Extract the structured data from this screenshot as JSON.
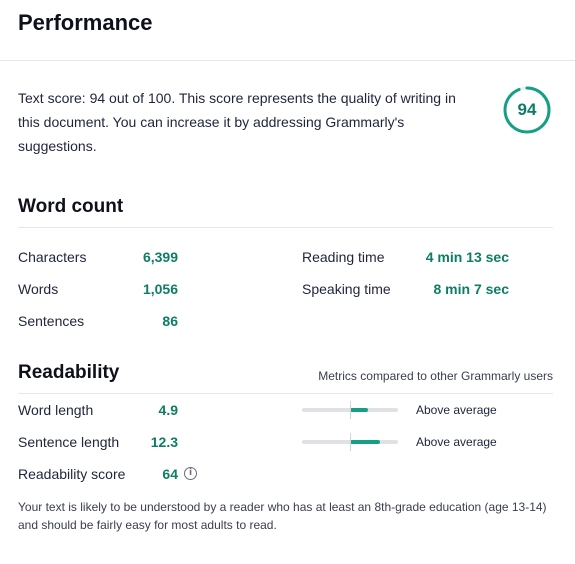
{
  "header": {
    "title": "Performance"
  },
  "score": {
    "text": "Text score: 94 out of 100. This score represents the quality of writing in this document. You can increase it by addressing Grammarly's suggestions.",
    "value": "94",
    "fraction": 0.94,
    "ring_color": "#15a085"
  },
  "word_count": {
    "title": "Word count",
    "left": [
      {
        "label": "Characters",
        "value": "6,399"
      },
      {
        "label": "Words",
        "value": "1,056"
      },
      {
        "label": "Sentences",
        "value": "86"
      }
    ],
    "right": [
      {
        "label": "Reading time",
        "value": "4 min 13 sec"
      },
      {
        "label": "Speaking time",
        "value": "8 min 7 sec"
      }
    ]
  },
  "readability": {
    "title": "Readability",
    "note": "Metrics compared to other Grammarly users",
    "metrics": [
      {
        "label": "Word length",
        "value": "4.9",
        "comparison": "Above average"
      },
      {
        "label": "Sentence length",
        "value": "12.3",
        "comparison": "Above average"
      },
      {
        "label": "Readability score",
        "value": "64"
      }
    ],
    "footnote": "Your text is likely to be understood by a reader who has at least an 8th-grade education (age 13-14) and should be fairly easy for most adults to read."
  },
  "icons": {
    "readability_info": "info-icon"
  },
  "colors": {
    "accent": "#0e7c66",
    "bar_fill": "#15a085",
    "bar_track": "#dfe1e5"
  }
}
